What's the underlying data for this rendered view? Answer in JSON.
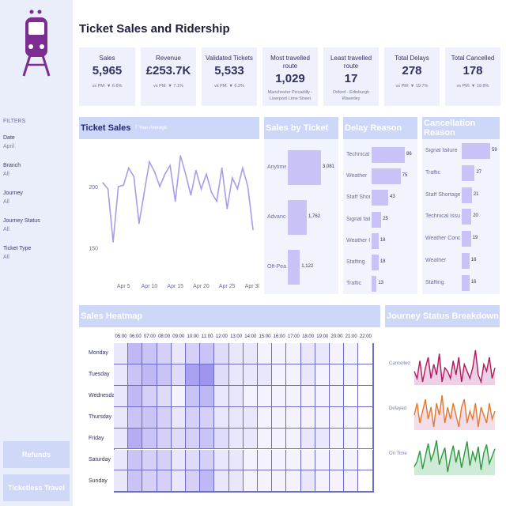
{
  "title": "Ticket Sales and Ridership",
  "kpis": [
    {
      "label": "Sales",
      "value": "5,965",
      "sub": "vs PM: ▼ 6.6%"
    },
    {
      "label": "Revenue",
      "value": "£253.7K",
      "sub": "vs PM: ▼ 7.1%"
    },
    {
      "label": "Validated Tickets",
      "value": "5,533",
      "sub": "vs PM: ▼ 6.2%"
    },
    {
      "label": "Most travelled route",
      "value": "1,029",
      "route": "Manchester Piccadilly - Liverpool Lime Street"
    },
    {
      "label": "Least travelled route",
      "value": "17",
      "route": "Oxford - Edinburgh Waverley"
    },
    {
      "label": "Total Delays",
      "value": "278",
      "sub": "vs PM: ▼ 19.7%"
    },
    {
      "label": "Total Cancelled",
      "value": "178",
      "sub": "vs PM: ▼ 19.8%"
    }
  ],
  "filters": {
    "title": "FILTERS",
    "items": [
      {
        "label": "Date",
        "value": "April"
      },
      {
        "label": "Branch",
        "value": "All"
      },
      {
        "label": "Journey",
        "value": "All"
      },
      {
        "label": "Journey Status",
        "value": "All"
      },
      {
        "label": "Ticket Type",
        "value": "All"
      }
    ]
  },
  "nav": {
    "refunds": "Refunds",
    "ticketless": "Ticketless Travel"
  },
  "panels": {
    "ticket_sales": {
      "title": "Ticket Sales",
      "subtitle": "7 Year Average"
    },
    "sales_by_ticket": {
      "title": "Sales by Ticket"
    },
    "delay_reason": {
      "title": "Delay Reason"
    },
    "cancellation_reason": {
      "title": "Cancellation Reason"
    },
    "sales_heatmap": {
      "title": "Sales Heatmap"
    },
    "journey_status": {
      "title": "Journey Status Breakdown"
    }
  },
  "colors": {
    "header": "#cdd7f7",
    "bar": "#c9c2f7",
    "heat_dark": "#9e95ef",
    "cancelled": "#b0195b",
    "delayed": "#e07a2f",
    "on_time": "#2a9a3c"
  },
  "icons": {
    "logo": "train-icon"
  },
  "chart_data": [
    {
      "type": "line",
      "title": "Ticket Sales",
      "x_ticks": [
        "Apr 5",
        "Apr 10",
        "Apr 15",
        "Apr 20",
        "Apr 25",
        "Apr 30"
      ],
      "y_ticks": [
        150,
        200
      ],
      "ylim": [
        128,
        232
      ],
      "x": [
        1,
        2,
        3,
        4,
        5,
        6,
        7,
        8,
        9,
        10,
        11,
        12,
        13,
        14,
        15,
        16,
        17,
        18,
        19,
        20,
        21,
        22,
        23,
        24,
        25,
        26,
        27,
        28,
        29,
        30
      ],
      "values": [
        203,
        198,
        155,
        200,
        201,
        215,
        208,
        170,
        195,
        220,
        212,
        200,
        210,
        217,
        188,
        225,
        210,
        193,
        213,
        198,
        210,
        195,
        188,
        215,
        182,
        207,
        198,
        215,
        200,
        165
      ]
    },
    {
      "type": "bar",
      "title": "Sales by Ticket",
      "categories": [
        "Anytime",
        "Advanced",
        "Off-Peak"
      ],
      "values": [
        3081,
        1762,
        1122
      ]
    },
    {
      "type": "bar",
      "title": "Delay Reason",
      "categories": [
        "Technical I..",
        "Weather",
        "Staff Short..",
        "Signal failu..",
        "Weather C..",
        "Staffing",
        "Traffic"
      ],
      "values": [
        86,
        75,
        43,
        25,
        18,
        18,
        13
      ]
    },
    {
      "type": "bar",
      "title": "Cancellation Reason",
      "categories": [
        "Signal failure",
        "Traffic",
        "Staff Shortage",
        "Technical Issue",
        "Weather Conditi..",
        "Weather",
        "Staffing"
      ],
      "values": [
        59,
        27,
        21,
        20,
        19,
        16,
        16
      ]
    },
    {
      "type": "heatmap",
      "title": "Sales Heatmap",
      "x_labels": [
        "05:00",
        "06:00",
        "07:00",
        "08:00",
        "09:00",
        "10:00",
        "11:00",
        "12:00",
        "13:00",
        "14:00",
        "15:00",
        "16:00",
        "17:00",
        "18:00",
        "19:00",
        "20:00",
        "21:00",
        "22:00"
      ],
      "y_labels": [
        "Monday",
        "Tuesday",
        "Wednesday",
        "Thursday",
        "Friday",
        "Saturday",
        "Sunday"
      ],
      "values": [
        [
          2,
          6,
          5,
          4,
          2,
          4,
          5,
          3,
          2,
          2,
          1,
          1,
          1,
          2,
          2,
          1,
          1,
          0
        ],
        [
          2,
          5,
          6,
          5,
          3,
          8,
          9,
          3,
          2,
          2,
          2,
          1,
          1,
          2,
          1,
          1,
          1,
          0
        ],
        [
          2,
          6,
          4,
          3,
          1,
          5,
          6,
          2,
          2,
          1,
          1,
          1,
          1,
          1,
          1,
          1,
          0,
          0
        ],
        [
          2,
          5,
          5,
          4,
          2,
          4,
          4,
          2,
          2,
          2,
          1,
          1,
          1,
          1,
          1,
          1,
          1,
          0
        ],
        [
          2,
          7,
          5,
          4,
          3,
          4,
          5,
          3,
          2,
          2,
          1,
          1,
          1,
          2,
          2,
          1,
          1,
          0
        ],
        [
          2,
          5,
          4,
          4,
          2,
          3,
          4,
          2,
          2,
          1,
          1,
          1,
          1,
          1,
          1,
          1,
          1,
          0
        ],
        [
          2,
          5,
          4,
          4,
          2,
          4,
          6,
          2,
          2,
          1,
          1,
          1,
          1,
          2,
          1,
          1,
          1,
          0
        ]
      ]
    },
    {
      "type": "line",
      "title": "Journey Status Breakdown",
      "series": [
        {
          "name": "Cancelled",
          "values": [
            5,
            3,
            8,
            2,
            6,
            9,
            3,
            7,
            4,
            10,
            2,
            6,
            5,
            3,
            8,
            4,
            9,
            2,
            7,
            5,
            3,
            6,
            11,
            4,
            2,
            7,
            5,
            9,
            3,
            6
          ]
        },
        {
          "name": "Delayed",
          "values": [
            6,
            9,
            4,
            7,
            10,
            5,
            8,
            3,
            9,
            6,
            11,
            4,
            8,
            5,
            9,
            6,
            3,
            8,
            10,
            4,
            7,
            5,
            9,
            3,
            8,
            6,
            4,
            9,
            5,
            7
          ]
        },
        {
          "name": "On Time",
          "values": [
            190,
            195,
            205,
            188,
            200,
            212,
            196,
            203,
            215,
            192,
            201,
            208,
            185,
            199,
            210,
            194,
            206,
            189,
            202,
            214,
            191,
            204,
            196,
            209,
            187,
            203,
            211,
            193,
            200,
            207
          ]
        }
      ]
    }
  ]
}
